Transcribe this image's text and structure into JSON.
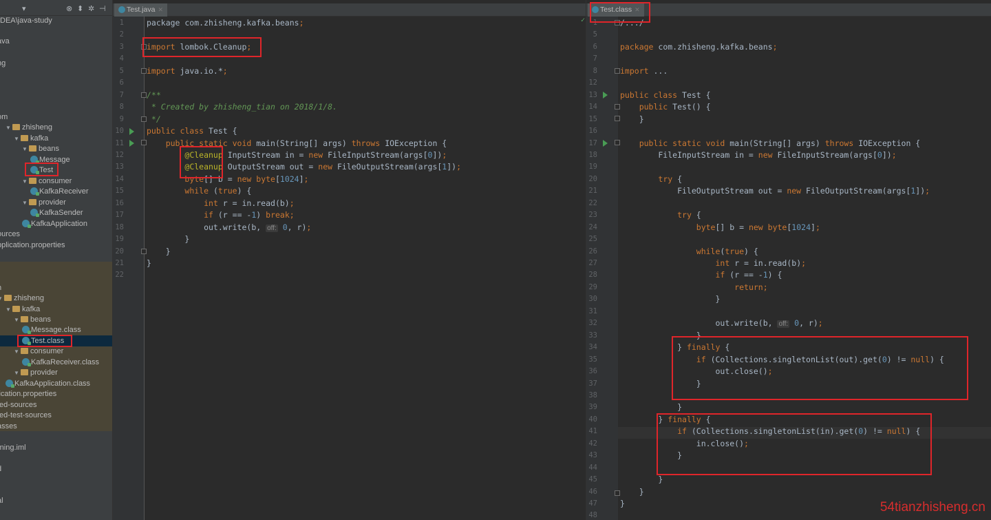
{
  "sidebar": {
    "project_path": "DEA\\java-study",
    "src_tree": [
      {
        "label": "ava",
        "indent": 0,
        "type": "text"
      },
      {
        "label": "ng",
        "indent": 0,
        "type": "text"
      },
      {
        "label": "om",
        "indent": 0,
        "type": "text"
      },
      {
        "label": "zhisheng",
        "indent": 1,
        "type": "pkg"
      },
      {
        "label": "kafka",
        "indent": 2,
        "type": "pkg"
      },
      {
        "label": "beans",
        "indent": 3,
        "type": "pkg"
      },
      {
        "label": "Message",
        "indent": 4,
        "type": "cls"
      },
      {
        "label": "Test",
        "indent": 4,
        "type": "cls"
      },
      {
        "label": "consumer",
        "indent": 3,
        "type": "pkg"
      },
      {
        "label": "KafkaReceiver",
        "indent": 4,
        "type": "cls"
      },
      {
        "label": "provider",
        "indent": 3,
        "type": "pkg"
      },
      {
        "label": "KafkaSender",
        "indent": 4,
        "type": "cls"
      },
      {
        "label": "KafkaApplication",
        "indent": 3,
        "type": "cls"
      },
      {
        "label": "ources",
        "indent": 0,
        "type": "text"
      },
      {
        "label": "pplication.properties",
        "indent": 0,
        "type": "text"
      }
    ],
    "out_tree": [
      {
        "label": "n",
        "indent": 0,
        "type": "text"
      },
      {
        "label": "zhisheng",
        "indent": 0,
        "type": "pkg"
      },
      {
        "label": "kafka",
        "indent": 1,
        "type": "pkg"
      },
      {
        "label": "beans",
        "indent": 2,
        "type": "pkg"
      },
      {
        "label": "Message.class",
        "indent": 3,
        "type": "cls"
      },
      {
        "label": "Test.class",
        "indent": 3,
        "type": "cls"
      },
      {
        "label": "consumer",
        "indent": 2,
        "type": "pkg"
      },
      {
        "label": "KafkaReceiver.class",
        "indent": 3,
        "type": "cls"
      },
      {
        "label": "provider",
        "indent": 2,
        "type": "pkg"
      },
      {
        "label": "KafkaApplication.class",
        "indent": 1,
        "type": "cls"
      },
      {
        "label": "lication.properties",
        "indent": 0,
        "type": "text"
      },
      {
        "label": "ted-sources",
        "indent": 0,
        "type": "text"
      },
      {
        "label": "ted-test-sources",
        "indent": 0,
        "type": "text"
      },
      {
        "label": "asses",
        "indent": 0,
        "type": "text"
      },
      {
        "label": "",
        "indent": 0,
        "type": "text"
      },
      {
        "label": "rning.iml",
        "indent": 0,
        "type": "text"
      },
      {
        "label": "",
        "indent": 0,
        "type": "text"
      },
      {
        "label": "d",
        "indent": 0,
        "type": "text"
      },
      {
        "label": "",
        "indent": 0,
        "type": "text"
      },
      {
        "label": "al",
        "indent": 0,
        "type": "text"
      }
    ]
  },
  "left_editor": {
    "tab_label": "Test.java",
    "line_numbers": [
      "1",
      "2",
      "3",
      "4",
      "5",
      "6",
      "7",
      "8",
      "9",
      "10",
      "11",
      "12",
      "13",
      "14",
      "15",
      "16",
      "17",
      "18",
      "19",
      "20",
      "21",
      "22"
    ],
    "lines": [
      [
        [
          "package com.zhisheng.kafka.beans",
          ""
        ],
        [
          ";",
          "kw"
        ]
      ],
      [],
      [
        [
          "import ",
          "kw"
        ],
        [
          "lombok.",
          ""
        ],
        [
          "Cleanup",
          ""
        ],
        [
          ";",
          "kw"
        ]
      ],
      [],
      [
        [
          "import ",
          "kw"
        ],
        [
          "java.io.*",
          ""
        ],
        [
          ";",
          "kw"
        ]
      ],
      [],
      [
        [
          "/**",
          "cmt"
        ]
      ],
      [
        [
          " * Created by ",
          "cmt"
        ],
        [
          "zhisheng_tian",
          "cmt"
        ],
        [
          " on 2018/1/8.",
          "cmt"
        ]
      ],
      [
        [
          " */",
          "cmt"
        ]
      ],
      [
        [
          "public class ",
          "kw"
        ],
        [
          "Test {",
          ""
        ]
      ],
      [
        [
          "    public static void ",
          "kw"
        ],
        [
          "main",
          ""
        ],
        [
          "(String[] args) ",
          ""
        ],
        [
          "throws ",
          "kw"
        ],
        [
          "IOException {",
          ""
        ]
      ],
      [
        [
          "        ",
          ""
        ],
        [
          "@Cleanup ",
          "ann"
        ],
        [
          "InputStream in = ",
          ""
        ],
        [
          "new ",
          "kw"
        ],
        [
          "FileInputStream(args[",
          ""
        ],
        [
          "0",
          "num"
        ],
        [
          "])",
          ""
        ],
        [
          ";",
          "kw"
        ]
      ],
      [
        [
          "        ",
          ""
        ],
        [
          "@Cleanup ",
          "ann"
        ],
        [
          "OutputStream out = ",
          ""
        ],
        [
          "new ",
          "kw"
        ],
        [
          "FileOutputStream(args[",
          ""
        ],
        [
          "1",
          "num"
        ],
        [
          "])",
          ""
        ],
        [
          ";",
          "kw"
        ]
      ],
      [
        [
          "        ",
          ""
        ],
        [
          "byte",
          "kw"
        ],
        [
          "[] b = ",
          ""
        ],
        [
          "new ",
          "kw"
        ],
        [
          "byte",
          "kw"
        ],
        [
          "[",
          ""
        ],
        [
          "1024",
          "num"
        ],
        [
          "]",
          ""
        ],
        [
          ";",
          "kw"
        ]
      ],
      [
        [
          "        ",
          ""
        ],
        [
          "while ",
          "kw"
        ],
        [
          "(",
          ""
        ],
        [
          "true",
          "kw"
        ],
        [
          ") {",
          ""
        ]
      ],
      [
        [
          "            ",
          ""
        ],
        [
          "int ",
          "kw"
        ],
        [
          "r = in.read(b)",
          ""
        ],
        [
          ";",
          "kw"
        ]
      ],
      [
        [
          "            ",
          ""
        ],
        [
          "if ",
          "kw"
        ],
        [
          "(r == -",
          ""
        ],
        [
          "1",
          "num"
        ],
        [
          ") ",
          ""
        ],
        [
          "break",
          "kw"
        ],
        [
          ";",
          "kw"
        ]
      ],
      [
        [
          "            out.write(b, ",
          ""
        ],
        [
          "off:",
          "hint"
        ],
        [
          " 0",
          "num"
        ],
        [
          ", r)",
          ""
        ],
        [
          ";",
          "kw"
        ]
      ],
      [
        [
          "        }",
          ""
        ]
      ],
      [
        [
          "    }",
          ""
        ]
      ],
      [
        [
          "}",
          ""
        ]
      ],
      []
    ]
  },
  "right_editor": {
    "tab_label": "Test.class",
    "line_numbers": [
      "1",
      "5",
      "6",
      "7",
      "8",
      "12",
      "13",
      "14",
      "15",
      "16",
      "17",
      "18",
      "19",
      "20",
      "21",
      "22",
      "23",
      "24",
      "25",
      "26",
      "27",
      "28",
      "29",
      "30",
      "31",
      "32",
      "33",
      "34",
      "35",
      "36",
      "37",
      "38",
      "39",
      "40",
      "41",
      "42",
      "43",
      "44",
      "45",
      "46",
      "47",
      "48"
    ],
    "lines": [
      [
        [
          "/.../",
          ""
        ]
      ],
      [],
      [
        [
          "package ",
          "kw"
        ],
        [
          "com.zhisheng.kafka.beans",
          ""
        ],
        [
          ";",
          "kw"
        ]
      ],
      [],
      [
        [
          "import ",
          "kw"
        ],
        [
          "...",
          ""
        ]
      ],
      [],
      [
        [
          "public class ",
          "kw"
        ],
        [
          "Test {",
          ""
        ]
      ],
      [
        [
          "    public ",
          "kw"
        ],
        [
          "Test() {",
          ""
        ]
      ],
      [
        [
          "    }",
          ""
        ]
      ],
      [],
      [
        [
          "    public static void ",
          "kw"
        ],
        [
          "main(String[] args) ",
          ""
        ],
        [
          "throws ",
          "kw"
        ],
        [
          "IOException {",
          ""
        ]
      ],
      [
        [
          "        FileInputStream in = ",
          ""
        ],
        [
          "new ",
          "kw"
        ],
        [
          "FileInputStream(args[",
          ""
        ],
        [
          "0",
          "num"
        ],
        [
          "])",
          ""
        ],
        [
          ";",
          "kw"
        ]
      ],
      [],
      [
        [
          "        ",
          ""
        ],
        [
          "try ",
          "kw"
        ],
        [
          "{",
          ""
        ]
      ],
      [
        [
          "            FileOutputStream out = ",
          ""
        ],
        [
          "new ",
          "kw"
        ],
        [
          "FileOutputStream(args[",
          ""
        ],
        [
          "1",
          "num"
        ],
        [
          "])",
          ""
        ],
        [
          ";",
          "kw"
        ]
      ],
      [],
      [
        [
          "            ",
          ""
        ],
        [
          "try ",
          "kw"
        ],
        [
          "{",
          ""
        ]
      ],
      [
        [
          "                ",
          ""
        ],
        [
          "byte",
          "kw"
        ],
        [
          "[] b = ",
          ""
        ],
        [
          "new ",
          "kw"
        ],
        [
          "byte",
          "kw"
        ],
        [
          "[",
          ""
        ],
        [
          "1024",
          "num"
        ],
        [
          "]",
          ""
        ],
        [
          ";",
          "kw"
        ]
      ],
      [],
      [
        [
          "                ",
          ""
        ],
        [
          "while",
          "kw"
        ],
        [
          "(",
          ""
        ],
        [
          "true",
          "kw"
        ],
        [
          ") {",
          ""
        ]
      ],
      [
        [
          "                    ",
          ""
        ],
        [
          "int ",
          "kw"
        ],
        [
          "r = in.read(b)",
          ""
        ],
        [
          ";",
          "kw"
        ]
      ],
      [
        [
          "                    ",
          ""
        ],
        [
          "if ",
          "kw"
        ],
        [
          "(r == -",
          ""
        ],
        [
          "1",
          "num"
        ],
        [
          ") {",
          ""
        ]
      ],
      [
        [
          "                        ",
          ""
        ],
        [
          "return",
          "kw"
        ],
        [
          ";",
          "kw"
        ]
      ],
      [
        [
          "                    }",
          ""
        ]
      ],
      [],
      [
        [
          "                    out.write(b, ",
          ""
        ],
        [
          "off:",
          "hint"
        ],
        [
          " 0",
          "num"
        ],
        [
          ", r)",
          ""
        ],
        [
          ";",
          "kw"
        ]
      ],
      [
        [
          "                }",
          ""
        ]
      ],
      [
        [
          "            } ",
          ""
        ],
        [
          "finally ",
          "kw"
        ],
        [
          "{",
          ""
        ]
      ],
      [
        [
          "                ",
          ""
        ],
        [
          "if ",
          "kw"
        ],
        [
          "(Collections.singletonList(out).get(",
          ""
        ],
        [
          "0",
          "num"
        ],
        [
          ") != ",
          ""
        ],
        [
          "null",
          "kw"
        ],
        [
          ") {",
          ""
        ]
      ],
      [
        [
          "                    out.close()",
          ""
        ],
        [
          ";",
          "kw"
        ]
      ],
      [
        [
          "                }",
          ""
        ]
      ],
      [],
      [
        [
          "            }",
          ""
        ]
      ],
      [
        [
          "        } ",
          ""
        ],
        [
          "finally ",
          "kw"
        ],
        [
          "{",
          ""
        ]
      ],
      [
        [
          "            ",
          ""
        ],
        [
          "if ",
          "kw"
        ],
        [
          "(Collections.singletonList(in).get(",
          ""
        ],
        [
          "0",
          "num"
        ],
        [
          ") != ",
          ""
        ],
        [
          "null",
          "kw"
        ],
        [
          ") {",
          ""
        ]
      ],
      [
        [
          "                in.close()",
          ""
        ],
        [
          ";",
          "kw"
        ]
      ],
      [
        [
          "            }",
          ""
        ]
      ],
      [],
      [
        [
          "        }",
          ""
        ]
      ],
      [
        [
          "    }",
          ""
        ]
      ],
      [
        [
          "}",
          ""
        ]
      ],
      []
    ]
  },
  "watermark": "54tianzhisheng.cn",
  "colors": {
    "keyword": "#cc7832",
    "number": "#6897bb",
    "annotation": "#bbb529",
    "comment": "#629755",
    "highlight_box": "#e0252a"
  }
}
